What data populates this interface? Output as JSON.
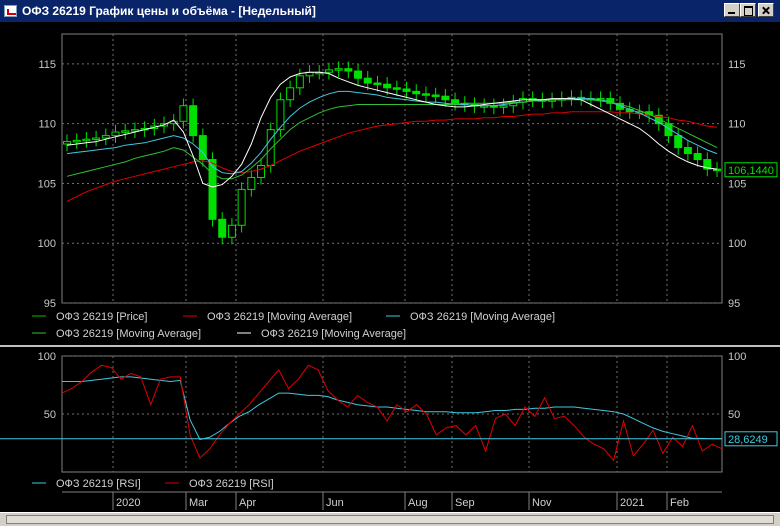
{
  "window": {
    "title": "ОФЗ 26219 График цены и объёма - [Недельный]"
  },
  "price_axis": {
    "ticks": [
      "115",
      "110",
      "105",
      "100",
      "95"
    ],
    "last_value": "106,1440"
  },
  "rsi_axis": {
    "ticks": [
      "100",
      "50"
    ],
    "last_value": "28,6249"
  },
  "legend_price": [
    {
      "label": "ОФЗ 26219 [Price]",
      "color": "#00c000"
    },
    {
      "label": "ОФЗ 26219 [Moving Average]",
      "color": "#e00000"
    },
    {
      "label": "ОФЗ 26219 [Moving Average]",
      "color": "#40c8e0"
    },
    {
      "label": "ОФЗ 26219 [Moving Average]",
      "color": "#30c030"
    },
    {
      "label": "ОФЗ 26219 [Moving Average]",
      "color": "#ffffff"
    }
  ],
  "legend_rsi": [
    {
      "label": "ОФЗ 26219 [RSI]",
      "color": "#40c8e0"
    },
    {
      "label": "ОФЗ 26219 [RSI]",
      "color": "#e00000"
    }
  ],
  "date_axis": [
    "2020",
    "Mar",
    "Apr",
    "Jun",
    "Aug",
    "Sep",
    "Nov",
    "2021",
    "Feb"
  ],
  "chart_data": [
    {
      "type": "candlestick",
      "ylim": [
        95,
        117.5
      ],
      "series": [
        {
          "name": "ОФЗ 26219 [Price]",
          "values": [
            108.5,
            108.6,
            108.7,
            108.8,
            109,
            109.3,
            109.4,
            109.5,
            109.6,
            109.8,
            110,
            110.2,
            111.5,
            109,
            107,
            102,
            100.5,
            101.5,
            104.5,
            105.5,
            106.5,
            109.5,
            112,
            113,
            114,
            114.3,
            114.3,
            114.5,
            114.6,
            114.4,
            113.8,
            113.4,
            113.3,
            113,
            112.9,
            112.7,
            112.5,
            112.4,
            112.3,
            112,
            111.7,
            111.6,
            111.5,
            111.5,
            111.4,
            111.5,
            111.8,
            112.1,
            112,
            111.9,
            112,
            112.1,
            112.2,
            112.1,
            112,
            112.1,
            111.7,
            111.2,
            111,
            111,
            110.7,
            110,
            109,
            108,
            107.5,
            107,
            106.2,
            106.144
          ]
        },
        {
          "name": "ОФЗ 26219 [Moving Average]",
          "values": [
            103.5,
            103.9,
            104.3,
            104.6,
            104.9,
            105.2,
            105.4,
            105.6,
            105.8,
            106,
            106.2,
            106.4,
            106.6,
            106.8,
            106.9,
            106.7,
            106.3,
            106,
            105.9,
            106,
            106.2,
            106.5,
            106.9,
            107.3,
            107.7,
            108,
            108.3,
            108.6,
            108.9,
            109.2,
            109.4,
            109.6,
            109.8,
            109.9,
            110,
            110.1,
            110.2,
            110.2,
            110.3,
            110.3,
            110.4,
            110.4,
            110.4,
            110.5,
            110.5,
            110.6,
            110.6,
            110.7,
            110.8,
            110.8,
            110.9,
            110.9,
            111,
            111,
            111,
            111,
            111,
            110.9,
            110.9,
            110.8,
            110.7,
            110.6,
            110.5,
            110.3,
            110.2,
            110,
            109.8,
            109.7
          ]
        },
        {
          "name": "ОФЗ 26219 [Moving Average]",
          "values": [
            107.5,
            107.6,
            107.7,
            107.8,
            107.9,
            108,
            108.2,
            108.3,
            108.4,
            108.6,
            108.8,
            109,
            108.8,
            108.3,
            107.6,
            106.4,
            105.9,
            105.8,
            106,
            106.7,
            107.6,
            108.7,
            109.7,
            110.6,
            111.3,
            111.8,
            112.2,
            112.5,
            112.7,
            112.7,
            112.6,
            112.5,
            112.4,
            112.2,
            112.1,
            112,
            111.9,
            111.8,
            111.8,
            111.7,
            111.6,
            111.6,
            111.5,
            111.5,
            111.5,
            111.6,
            111.7,
            111.8,
            111.9,
            112,
            112,
            112.1,
            112.1,
            112.1,
            112.1,
            112,
            111.8,
            111.5,
            111.2,
            110.9,
            110.5,
            110.1,
            109.6,
            109.1,
            108.6,
            108.2,
            107.8,
            107.5
          ]
        },
        {
          "name": "ОФЗ 26219 [Moving Average]",
          "values": [
            105.6,
            105.8,
            106,
            106.2,
            106.4,
            106.6,
            106.8,
            107.1,
            107.3,
            107.5,
            107.7,
            108,
            107.8,
            107.2,
            106.6,
            105.8,
            105.4,
            105.4,
            105.7,
            106.3,
            107,
            107.9,
            108.7,
            109.5,
            110.1,
            110.5,
            110.9,
            111.2,
            111.4,
            111.5,
            111.6,
            111.6,
            111.6,
            111.6,
            111.6,
            111.6,
            111.6,
            111.6,
            111.6,
            111.6,
            111.6,
            111.7,
            111.7,
            111.7,
            111.7,
            111.7,
            111.8,
            111.8,
            111.9,
            111.9,
            112,
            112,
            112,
            112,
            112,
            111.9,
            111.8,
            111.6,
            111.4,
            111.1,
            110.8,
            110.4,
            110,
            109.6,
            109.2,
            108.8,
            108.4,
            108
          ]
        },
        {
          "name": "ОФЗ 26219 [Moving Average]",
          "values": [
            108.2,
            108.3,
            108.4,
            108.5,
            108.7,
            108.9,
            109.1,
            109.3,
            109.5,
            109.7,
            109.9,
            110.3,
            109.3,
            107.3,
            105,
            104.7,
            104.9,
            105.6,
            106.6,
            108.3,
            110.5,
            112.2,
            113.3,
            113.9,
            114.2,
            114.3,
            114.3,
            114.2,
            113.8,
            113.5,
            113.2,
            113,
            112.8,
            112.6,
            112.4,
            112.2,
            112,
            111.8,
            111.6,
            111.5,
            111.4,
            111.4,
            111.5,
            111.6,
            111.7,
            111.8,
            111.9,
            112,
            112,
            112,
            112.1,
            112.1,
            112.1,
            112,
            111.6,
            111.2,
            110.8,
            110.4,
            110,
            109.6,
            109,
            108.3,
            107.7,
            107.2,
            106.8,
            106.5,
            106.3,
            106.2
          ]
        }
      ]
    },
    {
      "type": "line",
      "ylim": [
        0,
        100
      ],
      "series": [
        {
          "name": "ОФЗ 26219 [RSI]",
          "values": [
            78,
            78,
            78,
            79,
            80,
            81,
            82,
            82,
            81,
            80,
            79,
            78,
            79,
            45,
            28,
            30,
            35,
            42,
            48,
            52,
            58,
            63,
            68,
            68,
            67,
            66,
            66,
            65,
            62,
            60,
            58,
            57,
            56,
            56,
            55,
            54,
            53,
            52,
            52,
            52,
            51,
            51,
            51,
            52,
            53,
            53,
            54,
            54,
            55,
            55,
            56,
            56,
            56,
            55,
            54,
            53,
            52,
            50,
            46,
            42,
            38,
            35,
            33,
            31,
            29,
            29,
            28.6,
            28.6
          ]
        },
        {
          "name": "ОФЗ 26219 [RSI]",
          "values": [
            68,
            72,
            78,
            86,
            92,
            90,
            80,
            85,
            82,
            58,
            80,
            82,
            82,
            32,
            12,
            20,
            32,
            42,
            50,
            58,
            68,
            78,
            88,
            72,
            80,
            92,
            88,
            70,
            62,
            56,
            66,
            60,
            56,
            44,
            58,
            52,
            58,
            50,
            32,
            38,
            40,
            32,
            40,
            18,
            46,
            50,
            40,
            56,
            48,
            64,
            46,
            48,
            40,
            30,
            24,
            20,
            10,
            44,
            14,
            24,
            36,
            16,
            30,
            22,
            40,
            18,
            24,
            20
          ]
        }
      ]
    }
  ]
}
